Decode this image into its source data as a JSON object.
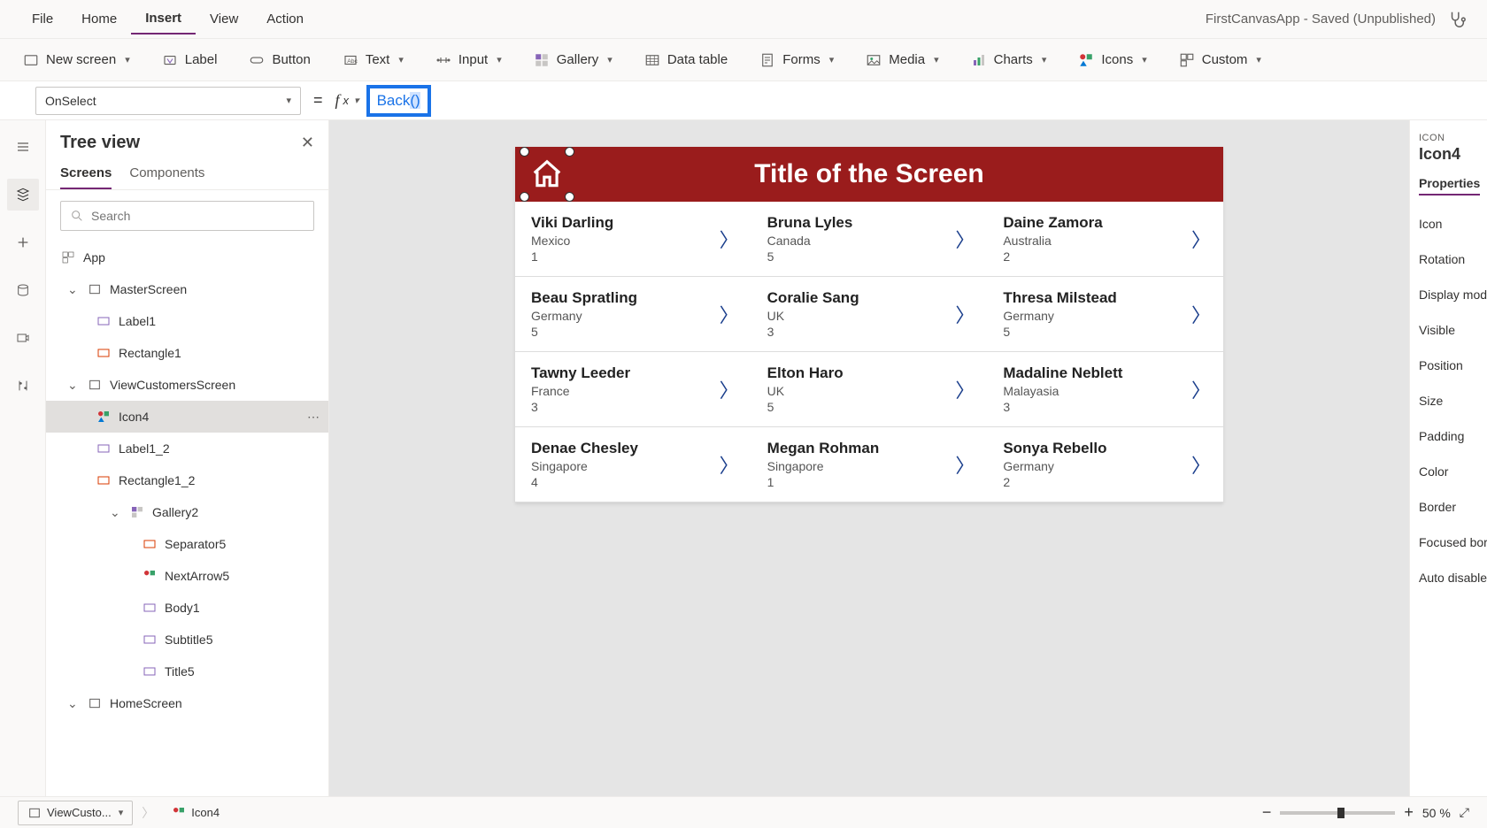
{
  "menubar": {
    "items": [
      "File",
      "Home",
      "Insert",
      "View",
      "Action"
    ],
    "active": "Insert",
    "app_state": "FirstCanvasApp - Saved (Unpublished)"
  },
  "toolbar": {
    "new_screen": "New screen",
    "label": "Label",
    "button": "Button",
    "text": "Text",
    "input": "Input",
    "gallery": "Gallery",
    "data_table": "Data table",
    "forms": "Forms",
    "media": "Media",
    "charts": "Charts",
    "icons": "Icons",
    "custom": "Custom"
  },
  "formula": {
    "property": "OnSelect",
    "function": "Back",
    "args": "()"
  },
  "treeview": {
    "title": "Tree view",
    "tabs": {
      "screens": "Screens",
      "components": "Components"
    },
    "search_placeholder": "Search",
    "nodes": {
      "app": "App",
      "master": "MasterScreen",
      "label1": "Label1",
      "rect1": "Rectangle1",
      "viewcust": "ViewCustomersScreen",
      "icon4": "Icon4",
      "label1_2": "Label1_2",
      "rect1_2": "Rectangle1_2",
      "gallery2": "Gallery2",
      "separator5": "Separator5",
      "nextarrow5": "NextArrow5",
      "body1": "Body1",
      "subtitle5": "Subtitle5",
      "title5": "Title5",
      "home": "HomeScreen"
    }
  },
  "canvas": {
    "title": "Title of the Screen",
    "gallery": [
      {
        "title": "Viki  Darling",
        "sub": "Mexico",
        "body": "1"
      },
      {
        "title": "Bruna  Lyles",
        "sub": "Canada",
        "body": "5"
      },
      {
        "title": "Daine  Zamora",
        "sub": "Australia",
        "body": "2"
      },
      {
        "title": "Beau  Spratling",
        "sub": "Germany",
        "body": "5"
      },
      {
        "title": "Coralie  Sang",
        "sub": "UK",
        "body": "3"
      },
      {
        "title": "Thresa  Milstead",
        "sub": "Germany",
        "body": "5"
      },
      {
        "title": "Tawny  Leeder",
        "sub": "France",
        "body": "3"
      },
      {
        "title": "Elton  Haro",
        "sub": "UK",
        "body": "5"
      },
      {
        "title": "Madaline  Neblett",
        "sub": "Malayasia",
        "body": "3"
      },
      {
        "title": "Denae  Chesley",
        "sub": "Singapore",
        "body": "4"
      },
      {
        "title": "Megan  Rohman",
        "sub": "Singapore",
        "body": "1"
      },
      {
        "title": "Sonya  Rebello",
        "sub": "Germany",
        "body": "2"
      }
    ]
  },
  "rightpane": {
    "type": "ICON",
    "name": "Icon4",
    "tab": "Properties",
    "rows": [
      "Icon",
      "Rotation",
      "Display mod",
      "Visible",
      "Position",
      "Size",
      "Padding",
      "Color",
      "Border",
      "Focused bor",
      "Auto disable"
    ]
  },
  "statusbar": {
    "bc_screen": "ViewCusto...",
    "bc_icon": "Icon4",
    "zoom_label": "50  %"
  }
}
